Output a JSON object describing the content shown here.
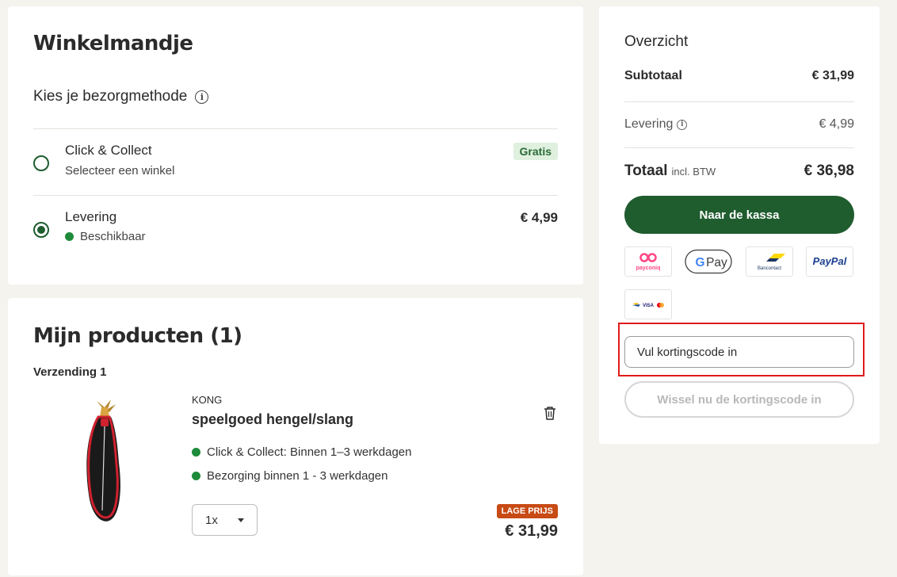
{
  "cart": {
    "title": "Winkelmandje",
    "delivery_heading": "Kies je bezorgmethode",
    "options": [
      {
        "title": "Click & Collect",
        "subtitle": "Selecteer een winkel",
        "badge": "Gratis",
        "selected": false
      },
      {
        "title": "Levering",
        "subtitle": "Beschikbaar",
        "price": "€ 4,99",
        "selected": true
      }
    ]
  },
  "products": {
    "title": "Mijn producten (1)",
    "shipment_label": "Verzending 1",
    "items": [
      {
        "brand": "KONG",
        "name": "speelgoed hengel/slang",
        "availability": [
          "Click & Collect: Binnen 1–3 werkdagen",
          "Bezorging binnen 1 - 3 werkdagen"
        ],
        "quantity": "1x",
        "badge": "LAGE PRIJS",
        "price": "€ 31,99"
      }
    ]
  },
  "overview": {
    "title": "Overzicht",
    "subtotal_label": "Subtotaal",
    "subtotal_value": "€ 31,99",
    "delivery_label": "Levering",
    "delivery_value": "€ 4,99",
    "total_label": "Totaal",
    "total_suffix": "incl. BTW",
    "total_value": "€ 36,98",
    "checkout_label": "Naar de kassa",
    "payment_methods": {
      "payconiq": "payconiq",
      "googlepay": "Pay",
      "bancontact": "Bancontact",
      "paypal": "PayPal",
      "visa": "VISA"
    },
    "discount_placeholder": "Vul kortingscode in",
    "redeem_label": "Wissel nu de kortingscode in"
  },
  "colors": {
    "primary_green": "#1f5c2e",
    "badge_green_bg": "#dff0df",
    "lage_prijs": "#c84a14",
    "highlight_red": "#e01b1b",
    "background": "#f5f3ee"
  }
}
